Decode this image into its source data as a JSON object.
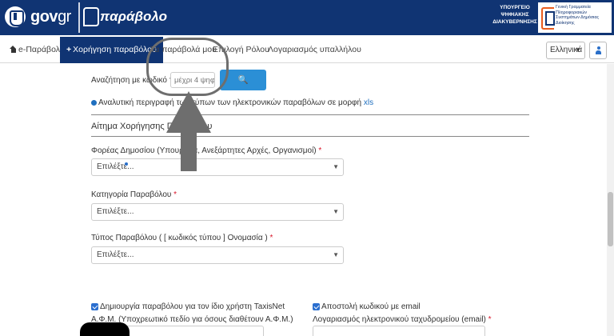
{
  "header": {
    "govgr": {
      "gov": "gov",
      "gr": "gr"
    },
    "app_logo": "παράβολο",
    "ministry": {
      "left": "ΥΠΟΥΡΓΕΙΟ ΨΗΦΙΑΚΗΣ ΔΙΑΚΥΒΕΡΝΗΣΗΣ",
      "right": "Γενική Γραμματεία Πληροφοριακών Συστημάτων Δημόσιας Διοίκησης"
    },
    "brand_color": "#103473"
  },
  "nav": {
    "items": [
      {
        "label": "e-Παράβολο",
        "icon": "home-icon"
      },
      {
        "label": "Χορήγηση παραβόλου",
        "icon": "plus-icon",
        "active": true
      },
      {
        "label": "Τα παράβολά μου"
      },
      {
        "label": "Επιλογή Ρόλου"
      },
      {
        "label": "Λογαριασμός υπαλλήλου"
      }
    ],
    "language": "Ελληνικά",
    "user_icon": "user-icon"
  },
  "search": {
    "label": "Αναζήτηση με κωδικό τύπου",
    "placeholder": "μέχρι 4 ψηφία",
    "button": "Αναζήτηση",
    "button_color": "#2b8fd6"
  },
  "info": {
    "text": "Αναλυτική περιγραφή των τύπων των ηλεκτρονικών παραβόλων σε μορφή",
    "link": "xls"
  },
  "form": {
    "title": "Αίτημα Χορήγησης Παραβόλου",
    "fields": [
      {
        "label": "Φορέας Δημοσίου (Υπουργεία, Ανεξάρτητες Αρχές, Οργανισμοί)",
        "required": "*",
        "value": "Επιλέξτε..."
      },
      {
        "label": "Κατηγορία Παραβόλου",
        "required": "*",
        "value": "Επιλέξτε..."
      },
      {
        "label": "Τύπος Παραβόλου ( [ κωδικός τύπου ] Ονομασία )",
        "required": "*",
        "value": "Επιλέξτε..."
      }
    ],
    "checkbox_left": "Δημιουργία παραβόλου για τον ίδιο χρήστη TaxisNet",
    "afm_label": "Α.Φ.Μ. (Υποχρεωτικό πεδίο για όσους διαθέτουν Α.Φ.Μ.)",
    "checkbox_right": "Αποστολή κωδικού με email",
    "email_label": "Λογαριασμός ηλεκτρονικού ταχυδρομείου (email)",
    "email_required": "*"
  },
  "annotation": {
    "shape": "ellipse-and-arrow",
    "color": "#6e6e6e"
  }
}
